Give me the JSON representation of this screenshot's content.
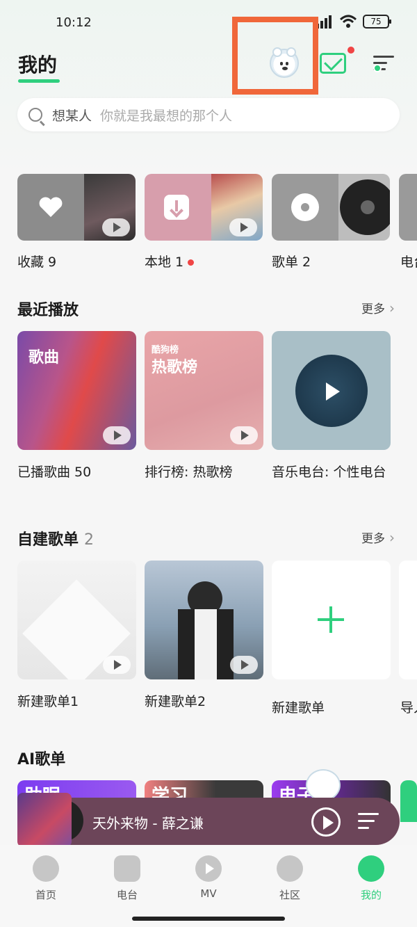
{
  "status": {
    "time": "10:12",
    "battery": "75"
  },
  "header": {
    "title": "我的"
  },
  "search": {
    "keyword": "想某人",
    "hint": "你就是我最想的那个人"
  },
  "quick_tiles": [
    {
      "label": "收藏 9"
    },
    {
      "label": "本地 1"
    },
    {
      "label": "歌单 2"
    },
    {
      "label": "电台"
    }
  ],
  "recent": {
    "title": "最近播放",
    "more": "更多",
    "items": [
      {
        "label": "已播歌曲 50",
        "overlay": "歌曲"
      },
      {
        "label": "排行榜: 热歌榜",
        "overlay_small": "酷狗榜",
        "overlay": "热歌榜"
      },
      {
        "label": "音乐电台: 个性电台"
      }
    ]
  },
  "my_playlists": {
    "title": "自建歌单",
    "count": "2",
    "more": "更多",
    "items": [
      {
        "label": "新建歌单1"
      },
      {
        "label": "新建歌单2"
      },
      {
        "label": "新建歌单"
      },
      {
        "label": "导入"
      }
    ]
  },
  "ai": {
    "title": "AI歌单",
    "tags": [
      "助眠",
      "学习",
      "电子"
    ]
  },
  "player": {
    "title": "天外来物 - 薛之谦"
  },
  "tabs": [
    {
      "label": "首页"
    },
    {
      "label": "电台"
    },
    {
      "label": "MV"
    },
    {
      "label": "社区"
    },
    {
      "label": "我的"
    }
  ],
  "colors": {
    "accent": "#2fcf7e",
    "highlight": "#f0673a",
    "badge": "#f04545",
    "player_bg": "#6c4559"
  }
}
